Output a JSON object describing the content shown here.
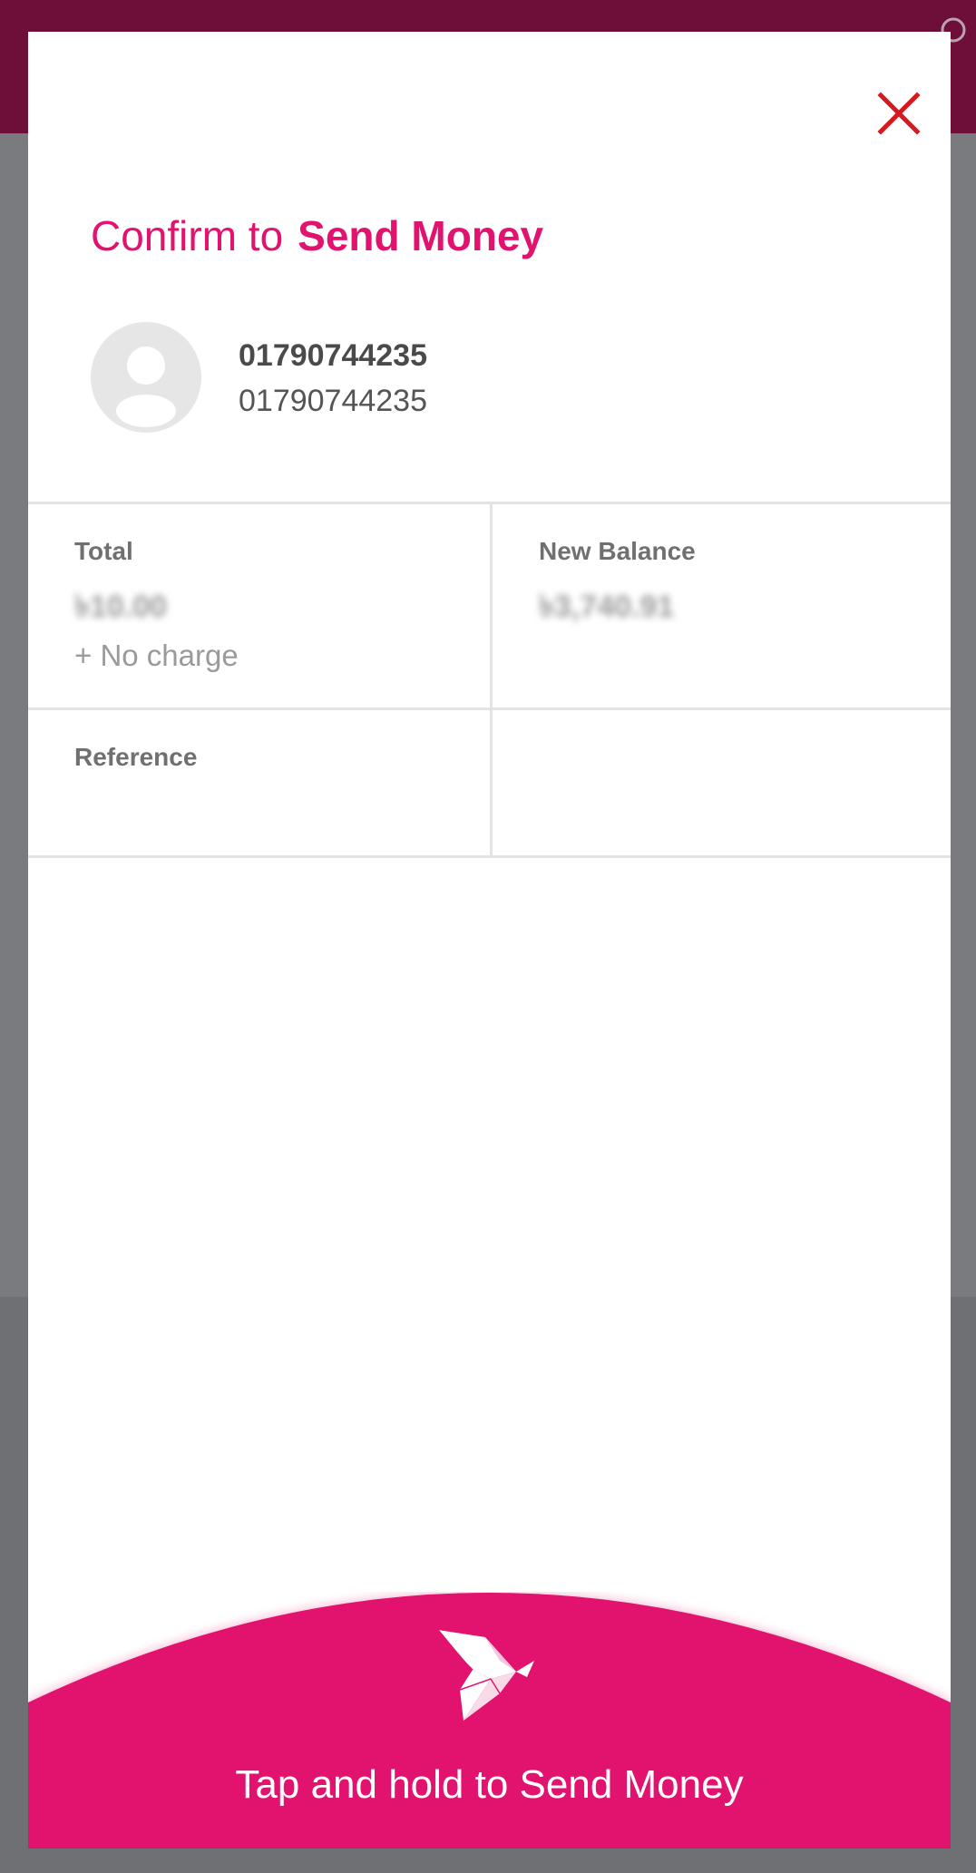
{
  "app": {
    "accent_color": "#e2136e",
    "appbar_color": "#6e0f3a"
  },
  "dialog": {
    "close_icon": "close-x-icon",
    "title_prefix": "Confirm to",
    "title_main": "Send Money",
    "recipient": {
      "avatar_icon": "person-avatar-icon",
      "name": "01790744235",
      "number": "01790744235"
    },
    "details": {
      "total_label": "Total",
      "total_value": "৳10.00",
      "charge_note": "+ No charge",
      "new_balance_label": "New Balance",
      "new_balance_value": "৳3,740.91",
      "reference_label": "Reference",
      "reference_value": ""
    },
    "send_action": {
      "icon": "origami-bird-icon",
      "label": "Tap and hold to Send Money"
    }
  }
}
